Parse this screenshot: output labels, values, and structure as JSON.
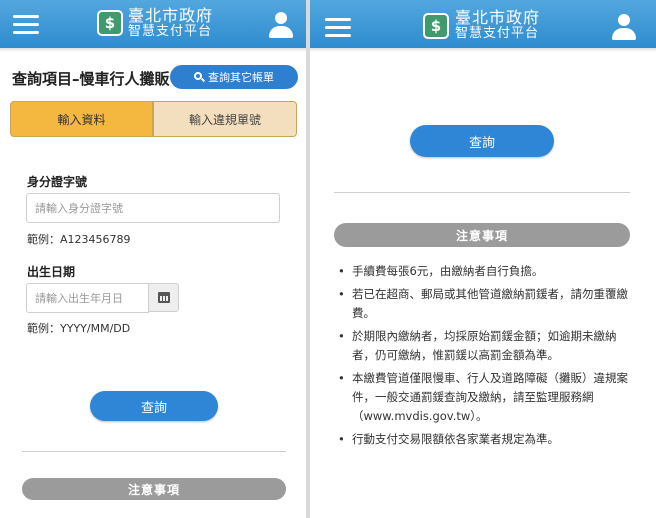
{
  "brand": {
    "title_line1": "臺北市政府",
    "title_line2": "智慧支付平台"
  },
  "left": {
    "page_title": "查詢項目–慢車行人攤販",
    "search_other_label": "查詢其它帳單",
    "tabs": [
      {
        "label": "輸入資料",
        "active": true
      },
      {
        "label": "輸入違規單號",
        "active": false
      }
    ],
    "id_field": {
      "label": "身分證字號",
      "placeholder": "請輸入身分證字號",
      "example": "範例：A123456789"
    },
    "dob_field": {
      "label": "出生日期",
      "placeholder": "請輸入出生年月日",
      "example": "範例：YYYY/MM/DD"
    },
    "query_label": "查詢",
    "notice_label": "注意事項"
  },
  "right": {
    "query_label": "查詢",
    "notice_label": "注意事項",
    "notes": [
      "手續費每張6元，由繳納者自行負擔。",
      "若已在超商、郵局或其他管道繳納罰鍰者，請勿重覆繳費。",
      "於期限內繳納者，均採原始罰鍰金額；如逾期未繳納者，仍可繳納，惟罰鍰以高罰金額為準。",
      "本繳費管道僅限慢車、行人及道路障礙（攤販）違規案件，一般交通罰鍰查詢及繳納，請至監理服務網（www.mvdis.gov.tw）。",
      "行動支付交易限額依各家業者規定為準。"
    ]
  },
  "colors": {
    "header": "#2f8ccf",
    "button": "#2f86d6",
    "tab_active": "#f4b73f",
    "tab_inactive": "#f3dfbd",
    "notice_bar": "#9b9b9b"
  }
}
